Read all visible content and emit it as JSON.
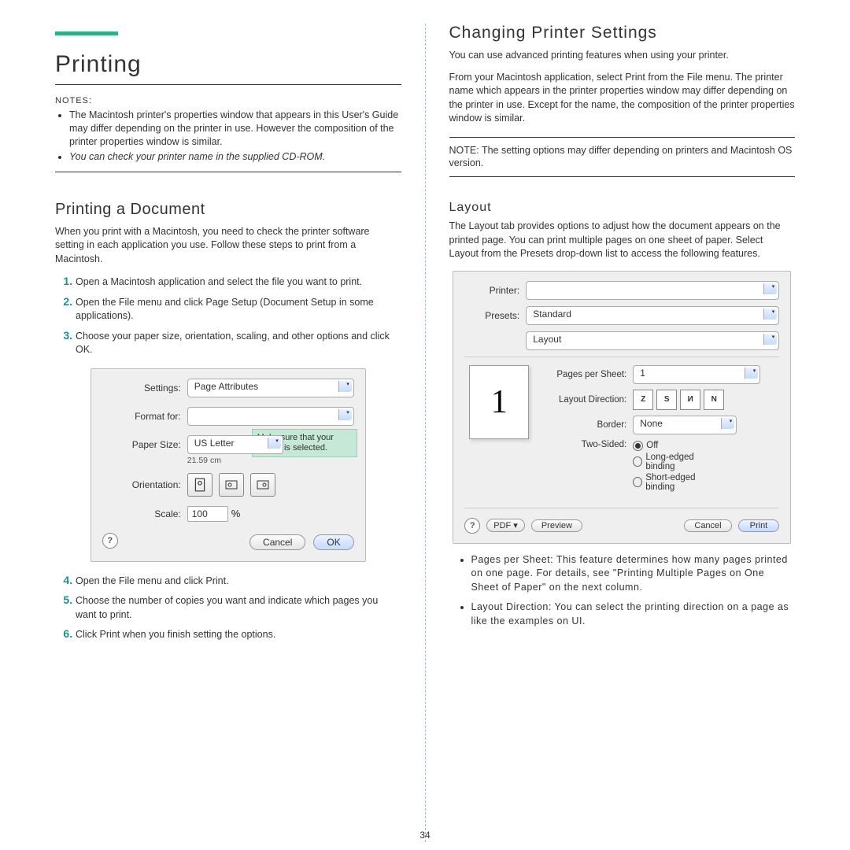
{
  "page_number": "34",
  "left": {
    "title": "Printing",
    "notes_label": "NOTES:",
    "note1": "The Macintosh printer's properties window that appears in this User's Guide may differ depending on the printer in use. However the composition of the printer properties window is similar.",
    "note2": "You can check your printer name in the supplied CD-ROM.",
    "section": "Printing a Document",
    "section_intro": "When you print with a Macintosh, you need to check the printer software setting in each application you use. Follow these steps to print from a Macintosh.",
    "step1": "Open a Macintosh application and select the file you want to print.",
    "step2": "Open the File menu and click Page Setup (Document Setup in some applications).",
    "step3": "Choose your paper size, orientation, scaling, and other options and click OK.",
    "step4": "Open the File menu and click Print.",
    "step5": "Choose the number of copies you want and indicate which pages you want to print.",
    "step6": "Click Print when you finish setting the options.",
    "dialog": {
      "settings_label": "Settings:",
      "settings_value": "Page Attributes",
      "format_label": "Format for:",
      "format_value": "",
      "paper_label": "Paper Size:",
      "paper_value": "US Letter",
      "paper_hint": "21.59 cm",
      "orientation_label": "Orientation:",
      "scale_label": "Scale:",
      "scale_value": "100",
      "scale_unit": "%",
      "callout": "Make sure that your printer is selected.",
      "cancel": "Cancel",
      "ok": "OK"
    }
  },
  "right": {
    "title": "Changing Printer Settings",
    "p1": "You can use advanced printing features when using your printer.",
    "p2": "From your Macintosh application, select Print from the File menu. The printer name which appears in the printer properties window may differ depending on the printer in use. Except for the name, the composition of the printer properties window is similar.",
    "note": "NOTE: The setting options may differ depending on printers and Macintosh OS version.",
    "layout_heading": "Layout",
    "layout_intro": "The Layout tab provides options to adjust how the document appears on the printed page. You can print multiple pages on one sheet of paper. Select Layout from the Presets drop-down list to access the following features.",
    "dialog": {
      "printer_label": "Printer:",
      "printer_value": "",
      "presets_label": "Presets:",
      "presets_value": "Standard",
      "panel_value": "Layout",
      "preview_digit": "1",
      "pages_label": "Pages per Sheet:",
      "pages_value": "1",
      "direction_label": "Layout Direction:",
      "border_label": "Border:",
      "border_value": "None",
      "twosided_label": "Two-Sided:",
      "twosided_off": "Off",
      "twosided_long": "Long-edged binding",
      "twosided_short": "Short-edged binding",
      "pdf": "PDF ▾",
      "preview": "Preview",
      "cancel": "Cancel",
      "print": "Print"
    },
    "bullet1": "Pages per Sheet: This feature determines how many pages printed on one page. For details, see \"Printing Multiple Pages on One Sheet of Paper\" on the next column.",
    "bullet2": "Layout Direction: You can select the printing direction on a page as like the examples on UI."
  }
}
